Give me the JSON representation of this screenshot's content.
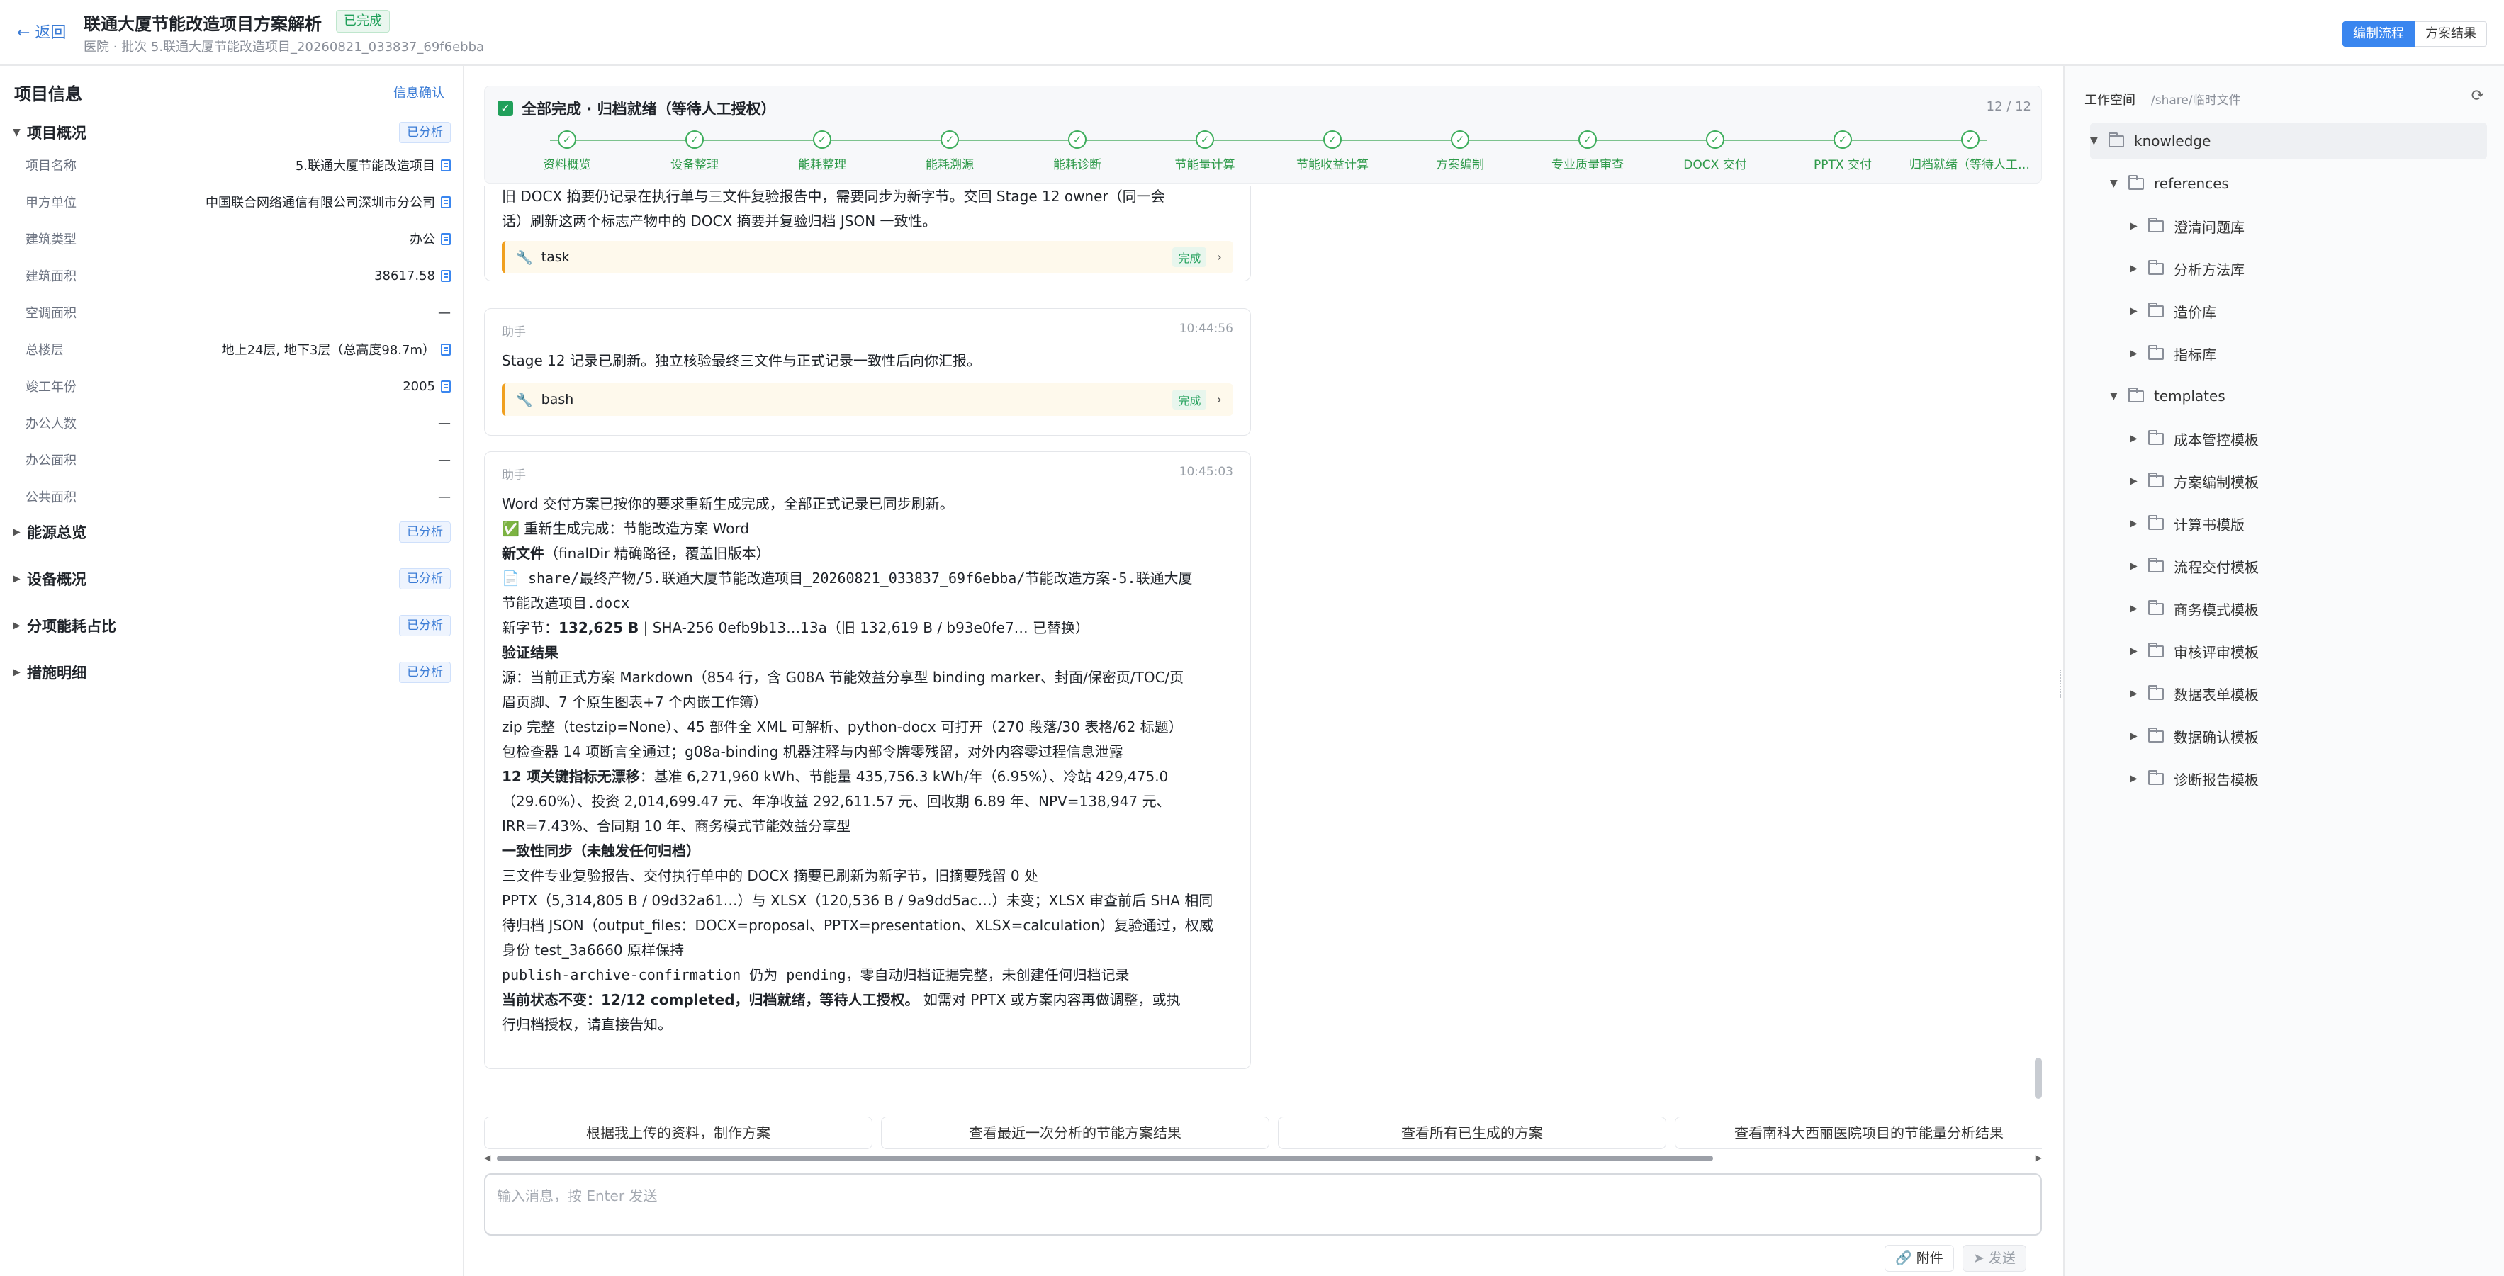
{
  "header": {
    "back": "← 返回",
    "title": "联通大厦节能改造项目方案解析",
    "status": "已完成",
    "subtitle": "医院 · 批次 5.联通大厦节能改造项目_20260821_033837_69f6ebba",
    "tabs": [
      "编制流程",
      "方案结果"
    ]
  },
  "left": {
    "title": "项目信息",
    "confirm": "信息确认",
    "overview": {
      "label": "项目概况",
      "tag": "已分析",
      "fields": [
        {
          "k": "项目名称",
          "v": "5.联通大厦节能改造项目",
          "doc": true
        },
        {
          "k": "甲方单位",
          "v": "中国联合网络通信有限公司深圳市分公司",
          "doc": true
        },
        {
          "k": "建筑类型",
          "v": "办公",
          "doc": true
        },
        {
          "k": "建筑面积",
          "v": "38617.58",
          "doc": true
        },
        {
          "k": "空调面积",
          "v": "—",
          "doc": false
        },
        {
          "k": "总楼层",
          "v": "地上24层, 地下3层（总高度98.7m）",
          "doc": true
        },
        {
          "k": "竣工年份",
          "v": "2005",
          "doc": true
        },
        {
          "k": "办公人数",
          "v": "—",
          "doc": false
        },
        {
          "k": "办公面积",
          "v": "—",
          "doc": false
        },
        {
          "k": "公共面积",
          "v": "—",
          "doc": false
        }
      ]
    },
    "sections": [
      {
        "label": "能源总览",
        "tag": "已分析"
      },
      {
        "label": "设备概况",
        "tag": "已分析"
      },
      {
        "label": "分项能耗占比",
        "tag": "已分析"
      },
      {
        "label": "措施明细",
        "tag": "已分析"
      }
    ]
  },
  "progress": {
    "title": "全部完成 · 归档就绪（等待人工授权）",
    "count": "12 / 12",
    "steps": [
      "资料概览",
      "设备整理",
      "能耗整理",
      "能耗溯源",
      "能耗诊断",
      "节能量计算",
      "节能收益计算",
      "方案编制",
      "专业质量审查",
      "DOCX 交付",
      "PPTX 交付",
      "归档就绪（等待人工授..."
    ]
  },
  "chat": {
    "m1": {
      "line1": "旧 DOCX 摘要仍记录在执行单与三文件复验报告中，需要同步为新字节。交回 Stage 12 owner（同一会",
      "line2": "话）刷新这两个标志产物中的 DOCX 摘要并复验归档 JSON 一致性。",
      "tool": "task",
      "tool_status": "完成"
    },
    "m2": {
      "who": "助手",
      "time": "10:44:56",
      "text": "Stage 12 记录已刷新。独立核验最终三文件与正式记录一致性后向你汇报。",
      "tool": "bash",
      "tool_status": "完成"
    },
    "m3": {
      "who": "助手",
      "time": "10:45:03",
      "l1": "Word 交付方案已按你的要求重新生成完成，全部正式记录已同步刷新。",
      "l2": "✅ 重新生成完成：节能改造方案 Word",
      "l3a": "新文件",
      "l3b": "（finalDir 精确路径，覆盖旧版本）",
      "l4": "📄 share/最终产物/5.联通大厦节能改造项目_20260821_033837_69f6ebba/节能改造方案-5.联通大厦",
      "l5": "节能改造项目.docx",
      "l6a": "新字节：",
      "l6b": "132,625 B",
      "l6c": " | SHA-256 0efb9b13…13a（旧 132,619 B / b93e0fe7… 已替换）",
      "l7": "验证结果",
      "l8": "源：当前正式方案 Markdown（854 行，含 G08A 节能效益分享型 binding marker、封面/保密页/TOC/页",
      "l9": "眉页脚、7 个原生图表+7 个内嵌工作簿）",
      "l10": "zip 完整（testzip=None）、45 部件全 XML 可解析、python-docx 可打开（270 段落/30 表格/62 标题）",
      "l11": "包检查器 14 项断言全通过；g08a-binding 机器注释与内部令牌零残留，对外内容零过程信息泄露",
      "l12a": "12 项关键指标无漂移",
      "l12b": "：基准 6,271,960 kWh、节能量 435,756.3 kWh/年（6.95%）、冷站 429,475.0",
      "l13": "（29.60%）、投资 2,014,699.47 元、年净收益 292,611.57 元、回收期 6.89 年、NPV=138,947 元、",
      "l14": "IRR=7.43%、合同期 10 年、商务模式节能效益分享型",
      "l15": "一致性同步（未触发任何归档）",
      "l16": "三文件专业复验报告、交付执行单中的 DOCX 摘要已刷新为新字节，旧摘要残留 0 处",
      "l17": "PPTX（5,314,805 B / 09d32a61…）与 XLSX（120,536 B / 9a9dd5ac…）未变；XLSX 审查前后 SHA 相同",
      "l18": "待归档 JSON（output_files：DOCX=proposal、PPTX=presentation、XLSX=calculation）复验通过，权威",
      "l19": "身份 test_3a6660 原样保持",
      "l20": "publish-archive-confirmation 仍为 pending，零自动归档证据完整，未创建任何归档记录",
      "l21a": "当前状态不变：12/12 completed，归档就绪，等待人工授权。",
      "l21b": " 如需对 PPTX 或方案内容再做调整，或执",
      "l22": "行归档授权，请直接告知。"
    }
  },
  "suggestions": [
    "根据我上传的资料，制作方案",
    "查看最近一次分析的节能方案结果",
    "查看所有已生成的方案",
    "查看南科大西丽医院项目的节能量分析结果"
  ],
  "composer": {
    "placeholder": "输入消息，按 Enter 发送",
    "attach": "附件",
    "send": "发送"
  },
  "workspace": {
    "title": "工作空间",
    "path": "/share/临时文件",
    "tree": [
      {
        "label": "knowledge",
        "level": 0,
        "open": true
      },
      {
        "label": "references",
        "level": 1,
        "open": true
      },
      {
        "label": "澄清问题库",
        "level": 2,
        "open": false
      },
      {
        "label": "分析方法库",
        "level": 2,
        "open": false
      },
      {
        "label": "造价库",
        "level": 2,
        "open": false
      },
      {
        "label": "指标库",
        "level": 2,
        "open": false
      },
      {
        "label": "templates",
        "level": 1,
        "open": true
      },
      {
        "label": "成本管控模板",
        "level": 2,
        "open": false
      },
      {
        "label": "方案编制模板",
        "level": 2,
        "open": false
      },
      {
        "label": "计算书模版",
        "level": 2,
        "open": false
      },
      {
        "label": "流程交付模板",
        "level": 2,
        "open": false
      },
      {
        "label": "商务模式模板",
        "level": 2,
        "open": false
      },
      {
        "label": "审核评审模板",
        "level": 2,
        "open": false
      },
      {
        "label": "数据表单模板",
        "level": 2,
        "open": false
      },
      {
        "label": "数据确认模板",
        "level": 2,
        "open": false
      },
      {
        "label": "诊断报告模板",
        "level": 2,
        "open": false
      }
    ]
  }
}
